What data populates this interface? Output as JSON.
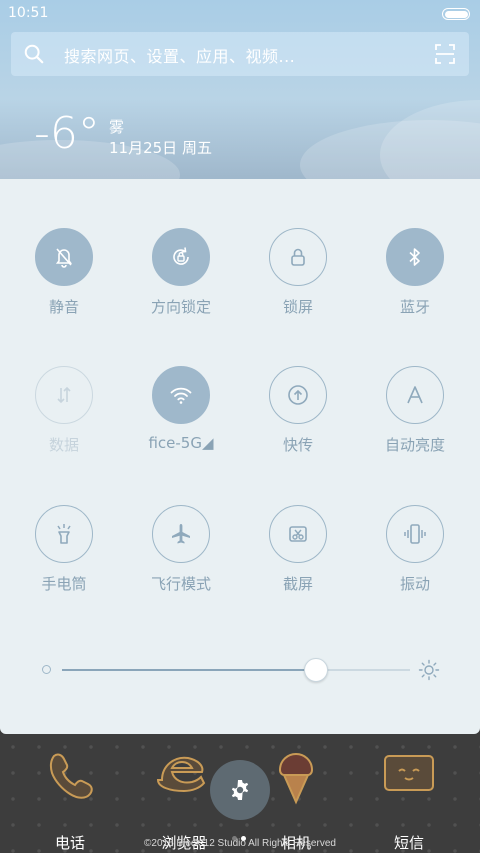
{
  "status_bar": {
    "time": "10:51"
  },
  "search": {
    "placeholder": "搜索网页、设置、应用、视频..."
  },
  "weather": {
    "temperature": "-6°",
    "condition": "雾",
    "date": "11月25日 周五"
  },
  "toggles": [
    {
      "label": "静音",
      "icon": "bell-off-icon",
      "state": "on"
    },
    {
      "label": "方向锁定",
      "icon": "rotation-lock-icon",
      "state": "on"
    },
    {
      "label": "锁屏",
      "icon": "lock-icon",
      "state": "off"
    },
    {
      "label": "蓝牙",
      "icon": "bluetooth-icon",
      "state": "on"
    },
    {
      "label": "数据",
      "icon": "mobile-data-icon",
      "state": "disabled"
    },
    {
      "label": "fice-5G◢",
      "icon": "wifi-icon",
      "state": "on"
    },
    {
      "label": "快传",
      "icon": "share-upload-icon",
      "state": "off"
    },
    {
      "label": "自动亮度",
      "icon": "auto-brightness-icon",
      "state": "off"
    },
    {
      "label": "手电筒",
      "icon": "flashlight-icon",
      "state": "off"
    },
    {
      "label": "飞行模式",
      "icon": "airplane-icon",
      "state": "off"
    },
    {
      "label": "截屏",
      "icon": "screenshot-icon",
      "state": "off"
    },
    {
      "label": "振动",
      "icon": "vibrate-icon",
      "state": "off"
    }
  ],
  "brightness": {
    "level": 0.73
  },
  "dock": {
    "apps": [
      {
        "label": "电话",
        "icon": "phone-icon"
      },
      {
        "label": "浏览器",
        "icon": "browser-icon"
      },
      {
        "label": "相机",
        "icon": "camera-icon"
      },
      {
        "label": "短信",
        "icon": "messages-icon"
      }
    ],
    "page_count": 2,
    "active_page": 1,
    "copyright": "©2016 Block 12 Studio All Rights Reserved"
  },
  "colors": {
    "panel_bg": "#e9f0f3",
    "toggle_on": "#9fb8cb",
    "toggle_outline": "#9eb7c8",
    "label": "#8aa3b5"
  }
}
